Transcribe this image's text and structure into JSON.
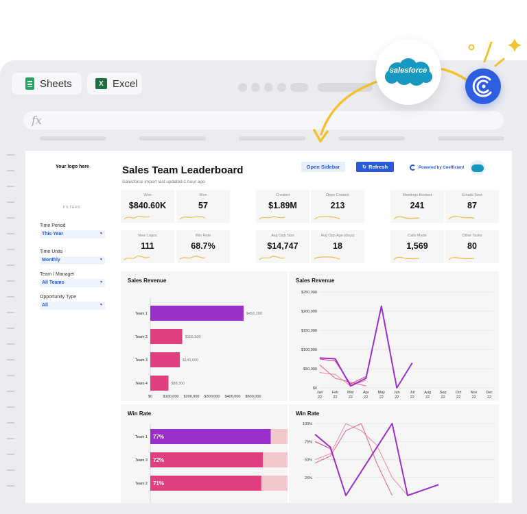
{
  "app_tabs": [
    {
      "label": "Sheets",
      "icon": "google-sheets-icon"
    },
    {
      "label": "Excel",
      "icon": "excel-icon",
      "icon_letter": "X"
    }
  ],
  "formula_bar": {
    "symbol": "fx",
    "value": ""
  },
  "dashboard": {
    "logo_placeholder": "Your logo here",
    "title": "Sales Team Leaderboard",
    "subtitle": "Salesforce import last updated 1 hour ago",
    "open_sidebar_label": "Open Sidebar",
    "refresh_label": "Refresh",
    "refresh_icon": "↻",
    "powered_by": "Powered by Coefficient",
    "accent": "#2a5bd7"
  },
  "filters": {
    "heading": "FILTERS",
    "items": [
      {
        "label": "Time Period",
        "value": "This Year"
      },
      {
        "label": "Time Units",
        "value": "Monthly"
      },
      {
        "label": "Team / Manager",
        "value": "All Teams"
      },
      {
        "label": "Opportunity Type",
        "value": "All"
      }
    ]
  },
  "kpis": [
    {
      "label": "Won",
      "value": "$840.60K"
    },
    {
      "label": "Won",
      "value": "57"
    },
    {
      "label": "Created",
      "value": "$1.89M"
    },
    {
      "label": "Opps Created",
      "value": "213"
    },
    {
      "label": "Meetings Booked",
      "value": "241"
    },
    {
      "label": "Emails Sent",
      "value": "87"
    },
    {
      "label": "New Logos",
      "value": "111"
    },
    {
      "label": "Win Rate",
      "value": "68.7%"
    },
    {
      "label": "Avg Opp Size",
      "value": "$14,747"
    },
    {
      "label": "Avg Opp Age (days)",
      "value": "18"
    },
    {
      "label": "Calls Made",
      "value": "1,569"
    },
    {
      "label": "Other Tasks",
      "value": "80"
    }
  ],
  "overlay": {
    "salesforce_label": "salesforce"
  },
  "chart_data": [
    {
      "type": "bar",
      "title": "Sales Revenue",
      "orientation": "horizontal",
      "categories": [
        "Team 1",
        "Team 2",
        "Team 3",
        "Team 4"
      ],
      "values": [
        453200,
        155500,
        143600,
        88300
      ],
      "value_labels": [
        "$453,200",
        "$155,500",
        "$143,600",
        "$88,300"
      ],
      "xlim": [
        0,
        500000
      ],
      "xticks": [
        "$0",
        "$100,000",
        "$200,000",
        "$300,000",
        "$400,000",
        "$500,000"
      ],
      "colors": [
        "#9b2fca",
        "#e0407f",
        "#e0407f",
        "#e0407f"
      ]
    },
    {
      "type": "line",
      "title": "Sales Revenue",
      "x": [
        "Jan 22",
        "Feb 22",
        "Mar 22",
        "Apr 22",
        "May 22",
        "Jun 22",
        "Jul 22",
        "Aug 22",
        "Sep 22",
        "Oct 22",
        "Nov 22",
        "Dec 22"
      ],
      "ylim": [
        0,
        250000
      ],
      "yticks": [
        "$250,000",
        "$200,000",
        "$150,000",
        "$100,000",
        "$50,000",
        "$0"
      ],
      "grid": true,
      "series": [
        {
          "color": "#9b2fca",
          "values": [
            78000,
            76000,
            5000,
            25000,
            213000,
            0,
            65000
          ]
        },
        {
          "color": "#e0407f",
          "values": [
            75000,
            70000,
            10000,
            30000,
            null,
            null,
            null
          ]
        },
        {
          "color": "#e86a9a",
          "values": [
            60000,
            25000,
            15000,
            5000,
            null,
            null,
            null
          ]
        },
        {
          "color": "#f08fb5",
          "values": [
            40000,
            35000,
            5000,
            20000,
            null,
            null,
            null
          ]
        }
      ]
    },
    {
      "type": "bar",
      "title": "Win Rate",
      "orientation": "horizontal",
      "stacked": true,
      "categories": [
        "Team 1",
        "Team 3",
        "Team 2"
      ],
      "values": [
        77,
        72,
        71
      ],
      "value_labels": [
        "77%",
        "72%",
        "71%"
      ],
      "remainder": [
        30,
        18,
        17
      ],
      "colors": [
        "#9b2fca",
        "#e0407f",
        "#e0407f"
      ],
      "remainder_color": "#f2c7cc"
    },
    {
      "type": "line",
      "title": "Win Rate",
      "ylim": [
        0,
        100
      ],
      "yticks": [
        "100%",
        "75%",
        "50%",
        "25%"
      ],
      "grid": true,
      "series": [
        {
          "color": "#9b2fca",
          "values": [
            85,
            67,
            0,
            null,
            null,
            100,
            0,
            null,
            15
          ]
        },
        {
          "color": "#e0407f",
          "values": [
            75,
            65,
            0,
            null,
            null,
            null,
            null,
            null,
            null
          ]
        },
        {
          "color": "#e86a9a",
          "values": [
            45,
            55,
            90,
            100,
            45,
            0,
            null,
            null,
            null
          ]
        },
        {
          "color": "#f08fb5",
          "values": [
            50,
            58,
            100,
            90,
            70,
            25,
            0,
            null,
            null
          ]
        }
      ]
    }
  ]
}
